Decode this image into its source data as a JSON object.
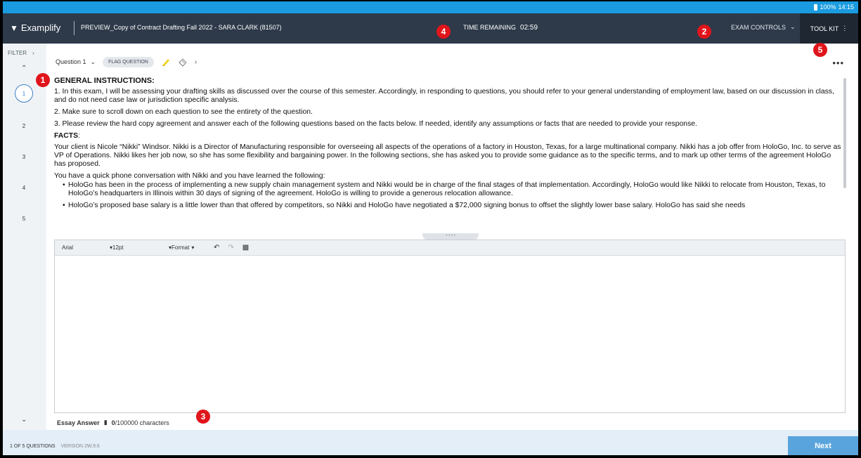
{
  "status_bar": {
    "battery": "100%",
    "time": "14:15"
  },
  "header": {
    "app_name": "Examplify",
    "exam_title": "PREVIEW_Copy of Contract Drafting Fall 2022 - SARA CLARK (81507)",
    "timer_label": "TIME REMAINING",
    "timer_value": "02:59",
    "exam_controls": "EXAM CONTROLS",
    "tool_kit": "TOOL KIT"
  },
  "badges": [
    "1",
    "2",
    "3",
    "4",
    "5"
  ],
  "sidebar": {
    "filter": "FILTER",
    "questions": [
      "1",
      "2",
      "3",
      "4",
      "5"
    ]
  },
  "question_bar": {
    "label": "Question 1",
    "flag": "FLAG QUESTION"
  },
  "question": {
    "heading_instructions": "GENERAL INSTRUCTIONS:",
    "instructions": [
      "1.  In this exam, I will be assessing your drafting skills as discussed over the course of this semester.  Accordingly, in responding to questions, you should refer to your general understanding of employment law, based on our discussion in class, and do not need case law or jurisdiction specific analysis.",
      "2.  Make sure to scroll down on each question to see the entirety of the question.",
      "3.  Please review the hard copy agreement and answer each of the following questions based on the facts below.  If needed, identify any assumptions or facts that are needed to provide your response."
    ],
    "heading_facts": "FACTS",
    "facts_colon": ":",
    "facts": [
      "Your client is Nicole “Nikki” Windsor.  Nikki is a Director of Manufacturing responsible for overseeing all aspects of the operations of a factory in Houston, Texas, for a large multinational company. Nikki has a job offer from HoloGo, Inc. to serve as VP of Operations.  Nikki likes her job now, so she has some flexibility and bargaining power.  In the following sections, she has asked you to provide some guidance as to the specific terms, and to mark up other terms of the agreement HoloGo has proposed.",
      "You have a quick phone conversation with Nikki and you have learned the following:"
    ],
    "bullets": [
      "HoloGo has been in the process of implementing a new supply chain management system and Nikki would be in charge of the final stages of that implementation.  Accordingly, HoloGo would like Nikki to relocate from Houston, Texas, to HoloGo’s headquarters in Illinois within 30 days of signing of the agreement.  HoloGo is willing to provide a generous relocation allowance.",
      "HoloGo’s proposed base salary is a little lower than that offered by competitors, so Nikki and HoloGo have negotiated a $72,000 signing bonus to offset the slightly lower base salary.  HoloGo has said she needs"
    ]
  },
  "editor": {
    "font": "Arial",
    "size": "12pt",
    "format": "Format"
  },
  "essay": {
    "label": "Essay Answer",
    "count": "0",
    "limit": "/100000 characters"
  },
  "footer": {
    "question_count": "1 OF 5 QUESTIONS",
    "version": "VERSION 2W.9.6",
    "next": "Next"
  },
  "colors": {
    "status_bar": "#1a9be0",
    "header": "#2e3a4a",
    "badge": "#e0151b",
    "next_button": "#5aa4dd"
  }
}
